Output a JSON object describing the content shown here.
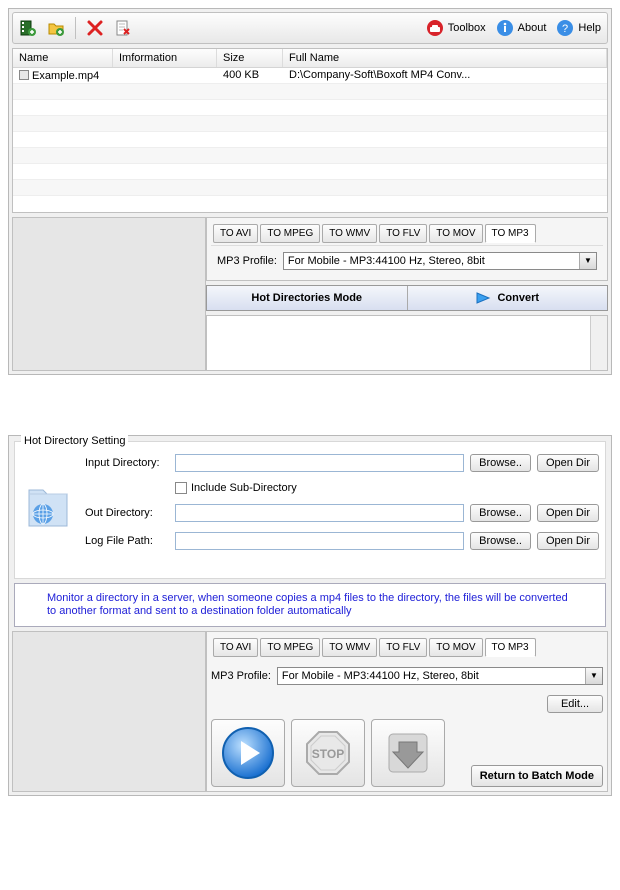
{
  "toolbar": {
    "toolbox_label": "Toolbox",
    "about_label": "About",
    "help_label": "Help"
  },
  "table": {
    "cols": {
      "name": "Name",
      "info": "Imformation",
      "size": "Size",
      "fullname": "Full Name"
    },
    "rows": [
      {
        "name": "Example.mp4",
        "info": "",
        "size": "400 KB",
        "fullname": "D:\\Company-Soft\\Boxoft MP4 Conv..."
      }
    ]
  },
  "tabs": {
    "items": [
      "TO AVI",
      "TO MPEG",
      "TO WMV",
      "TO FLV",
      "TO MOV",
      "TO MP3"
    ],
    "active_index": 5
  },
  "profile": {
    "label": "MP3 Profile:",
    "value": "For Mobile - MP3:44100 Hz, Stereo, 8bit"
  },
  "modebar": {
    "hot": "Hot Directories Mode",
    "convert": "Convert"
  },
  "hotdir": {
    "legend": "Hot Directory Setting",
    "input_label": "Input Directory:",
    "include_sub": "Include Sub-Directory",
    "out_label": "Out Directory:",
    "log_label": "Log File Path:",
    "browse": "Browse..",
    "browse_dot": "Browse..",
    "open_dir": "Open Dir",
    "input_val": "",
    "out_val": "",
    "log_val": ""
  },
  "note": "Monitor a directory in a server, when someone copies a mp4 files to the directory, the files will be converted to another format and sent to a destination folder automatically",
  "tabs2": {
    "items": [
      "TO AVI",
      "TO MPEG",
      "TO WMV",
      "TO FLV",
      "TO MOV",
      "TO MP3"
    ],
    "active_index": 5
  },
  "profile2": {
    "label": "MP3 Profile:",
    "value": "For Mobile - MP3:44100 Hz, Stereo, 8bit"
  },
  "buttons": {
    "edit": "Edit...",
    "return_batch": "Return to Batch Mode"
  }
}
